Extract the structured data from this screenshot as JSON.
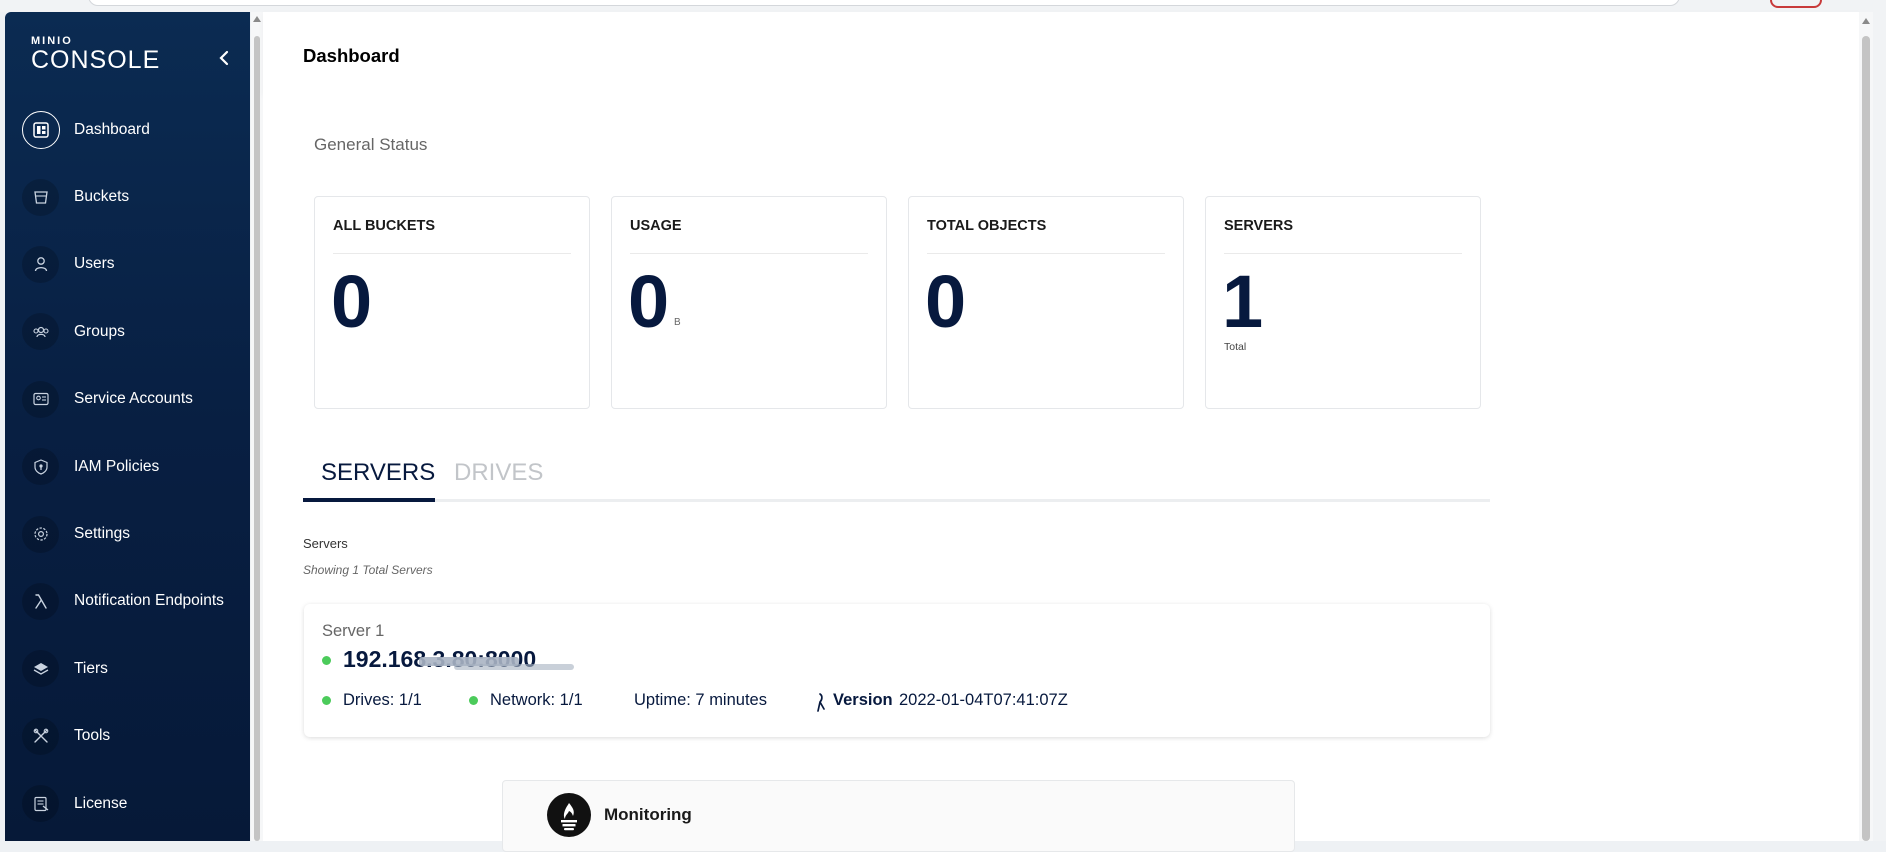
{
  "brand": {
    "small": "MINIO",
    "big": "CONSOLE"
  },
  "sidebar": {
    "items": [
      {
        "label": "Dashboard",
        "icon": "dashboard-icon",
        "active": true
      },
      {
        "label": "Buckets",
        "icon": "bucket-icon"
      },
      {
        "label": "Users",
        "icon": "user-icon"
      },
      {
        "label": "Groups",
        "icon": "groups-icon"
      },
      {
        "label": "Service Accounts",
        "icon": "service-account-icon"
      },
      {
        "label": "IAM Policies",
        "icon": "shield-icon"
      },
      {
        "label": "Settings",
        "icon": "gear-icon"
      },
      {
        "label": "Notification Endpoints",
        "icon": "lambda-icon"
      },
      {
        "label": "Tiers",
        "icon": "layers-icon"
      },
      {
        "label": "Tools",
        "icon": "tools-icon"
      },
      {
        "label": "License",
        "icon": "license-icon"
      }
    ]
  },
  "header": {
    "title": "Dashboard"
  },
  "status": {
    "title": "General Status",
    "cards": [
      {
        "label": "ALL BUCKETS",
        "value": "0"
      },
      {
        "label": "USAGE",
        "value": "0",
        "unit": "B"
      },
      {
        "label": "TOTAL OBJECTS",
        "value": "0"
      },
      {
        "label": "SERVERS",
        "value": "1",
        "sub": "Total"
      }
    ]
  },
  "tabs": [
    {
      "label": "SERVERS",
      "active": true
    },
    {
      "label": "DRIVES",
      "active": false
    }
  ],
  "servers": {
    "title": "Servers",
    "subtitle": "Showing 1 Total Servers",
    "items": [
      {
        "name": "Server 1",
        "address": "192.168.3.80:8000",
        "drives": "Drives: 1/1",
        "network": "Network: 1/1",
        "uptime": "Uptime: 7 minutes",
        "version_label": "Version",
        "version": "2022-01-04T07:41:07Z"
      }
    ]
  },
  "monitoring": {
    "title": "Monitoring"
  },
  "colors": {
    "navy": "#07193e",
    "sidebar": "#0b2b52",
    "online": "#4ccb5b"
  }
}
